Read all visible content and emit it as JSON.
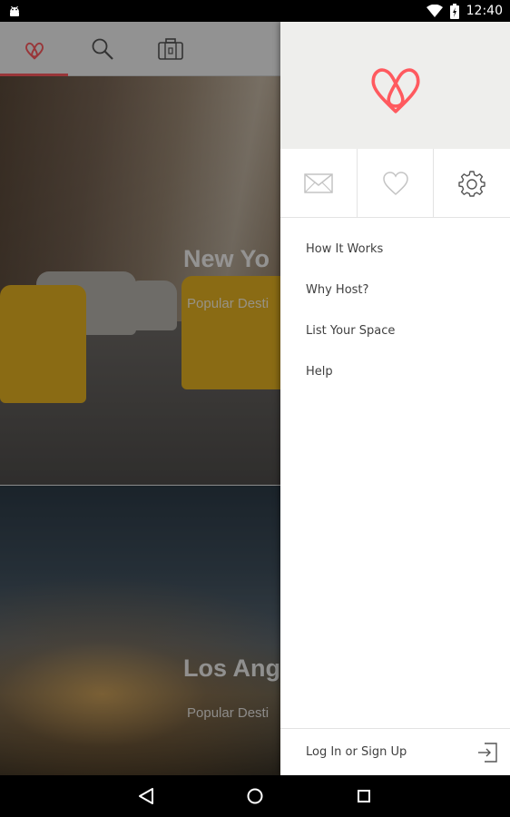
{
  "status_bar": {
    "time": "12:40",
    "icons": [
      "android-debug-icon",
      "wifi-icon",
      "battery-charging-icon"
    ]
  },
  "app": {
    "tabs": [
      {
        "icon": "airbnb-logo-icon",
        "active": true
      },
      {
        "icon": "search-icon",
        "active": false
      },
      {
        "icon": "suitcase-icon",
        "active": false
      }
    ],
    "destinations": [
      {
        "title": "New York",
        "visible_title": "New Yo",
        "subtitle": "Popular Desti"
      },
      {
        "title": "Los Angeles",
        "visible_title": "Los Ang",
        "subtitle": "Popular Desti"
      }
    ]
  },
  "drawer": {
    "logo": "airbnb-logo-icon",
    "quick_icons": [
      "mail-icon",
      "heart-icon",
      "gear-icon"
    ],
    "menu": {
      "items": [
        {
          "label": "How It Works"
        },
        {
          "label": "Why Host?"
        },
        {
          "label": "List Your Space"
        },
        {
          "label": "Help"
        }
      ]
    },
    "footer": {
      "login_label": "Log In or Sign Up",
      "icon": "login-icon"
    }
  },
  "nav_bar": {
    "buttons": [
      "back-icon",
      "home-icon",
      "recent-apps-icon"
    ]
  },
  "colors": {
    "brand": "#ff5a5f",
    "drawer_header_bg": "#eeeeec",
    "menu_text": "#3f3f3f",
    "icon_gray": "#b8b8b8"
  }
}
